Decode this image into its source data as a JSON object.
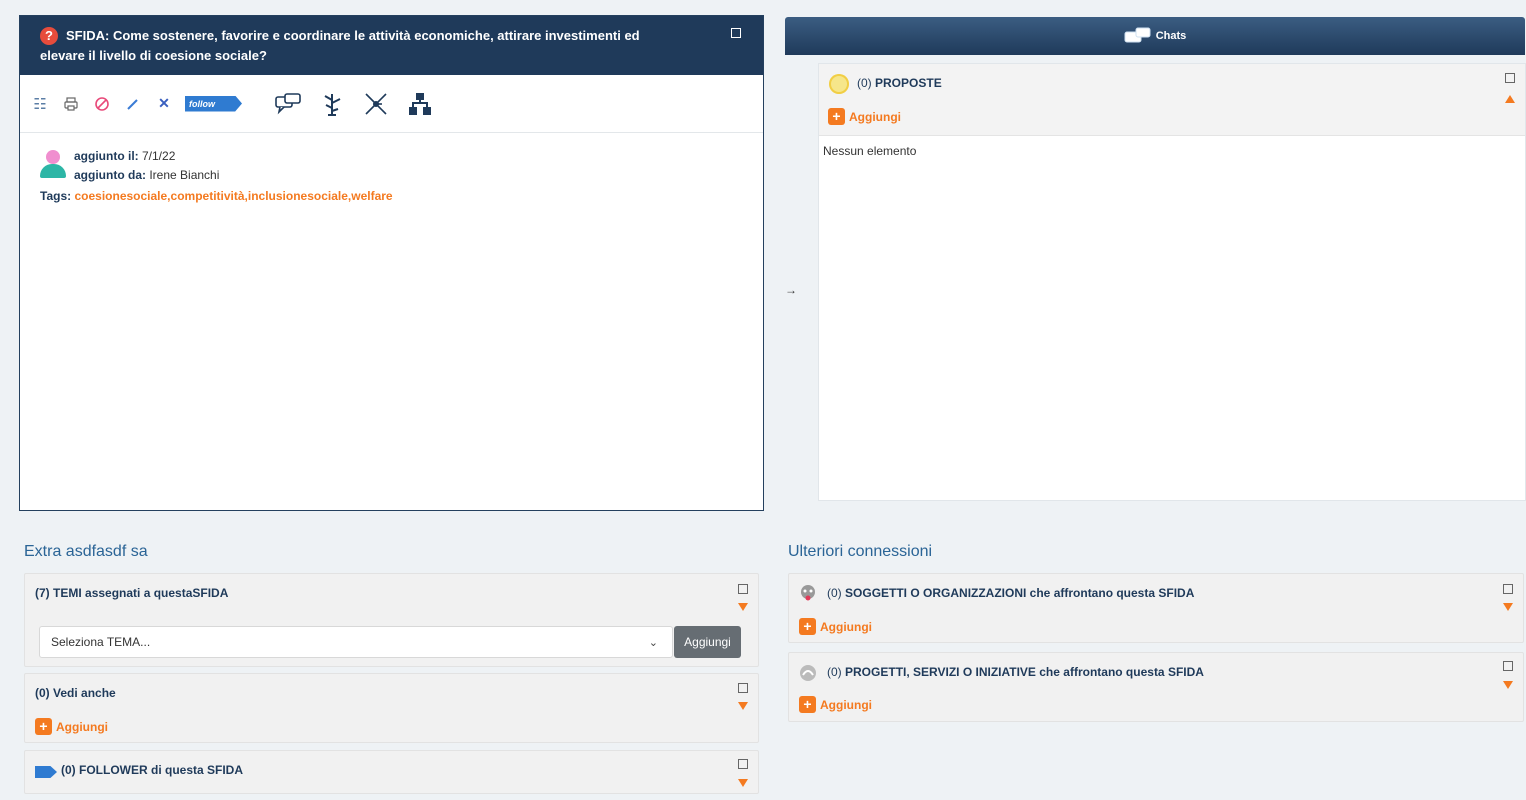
{
  "challenge": {
    "q_icon": "?",
    "title_line1": "SFIDA: Come sostenere, favorire e coordinare le attività economiche, attirare investimenti ed",
    "title_line2": "elevare il livello di coesione sociale?",
    "follow_label": "follow",
    "added_on_label": "aggiunto il:",
    "added_on_value": "7/1/22",
    "added_by_label": "aggiunto da:",
    "added_by_value": "Irene Bianchi",
    "tags_label": "Tags:",
    "tags_value": "coesionesociale,competitività,inclusionesociale,welfare"
  },
  "toolbar_icons": [
    "list-icon",
    "print-icon",
    "stop-icon",
    "pencil-icon",
    "close-icon",
    "follow-button",
    "chat-icon",
    "tree-icon",
    "network-icon",
    "hierarchy-icon"
  ],
  "chats": {
    "label": "Chats"
  },
  "middle_arrow": "→",
  "proposte": {
    "count": "(0)",
    "title": "PROPOSTE",
    "add_label": "Aggiungi",
    "empty_text": "Nessun elemento"
  },
  "extra": {
    "title": "Extra asdfasdf sa",
    "temi": {
      "count": "(7)",
      "title": "TEMI assegnati a questaSFIDA",
      "select_value": "Seleziona TEMA...",
      "button_label": "Aggiungi"
    },
    "vedi_anche": {
      "count": "(0)",
      "title": "Vedi anche",
      "add_label": "Aggiungi"
    },
    "follower": {
      "count": "(0)",
      "title": "FOLLOWER di questa SFIDA"
    }
  },
  "connessioni": {
    "title": "Ulteriori connessioni",
    "soggetti": {
      "count": "(0)",
      "title": "SOGGETTI O ORGANIZZAZIONI che affrontano questa SFIDA",
      "add_label": "Aggiungi"
    },
    "progetti": {
      "count": "(0)",
      "title": "PROGETTI, SERVIZI O INIZIATIVE che affrontano questa SFIDA",
      "add_label": "Aggiungi"
    }
  },
  "colors": {
    "header_navy": "#1f3a5a",
    "accent_orange": "#f47a20",
    "link_blue": "#2a6496",
    "follow_blue": "#2f7bd1"
  }
}
